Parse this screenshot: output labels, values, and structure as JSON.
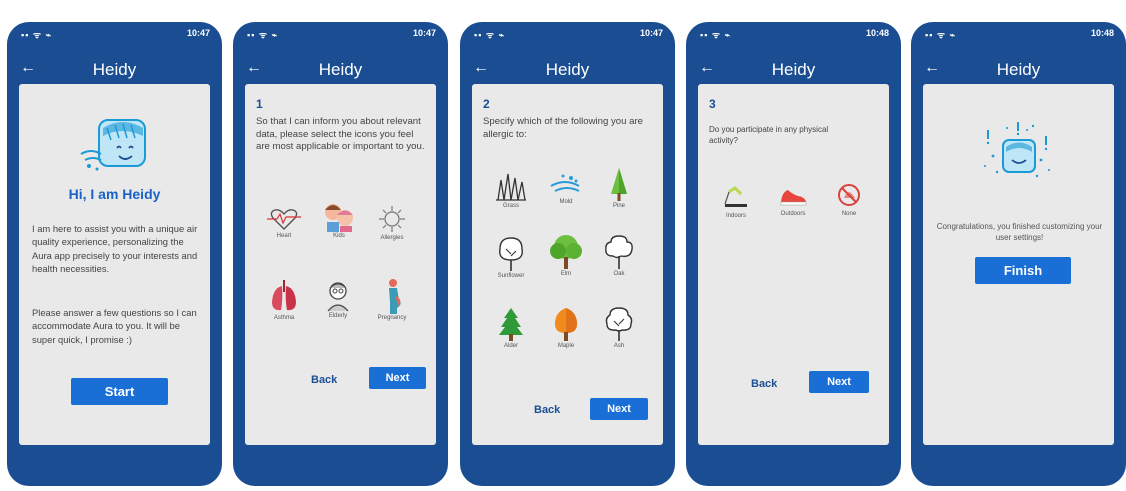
{
  "screens": [
    {
      "time": "10:47",
      "title": "Heidy",
      "greeting": "Hi, I am Heidy",
      "para1": "I am here to assist you with a unique air quality experience, personalizing the Aura app precisely to your interests and health necessities.",
      "para2": "Please answer a few questions so I can accommodate Aura to you. It will be super quick, I promise :)",
      "start_label": "Start"
    },
    {
      "time": "10:47",
      "title": "Heidy",
      "step": "1",
      "question": "So that I can inform you about relevant data, please select the icons you feel are most applicable or important to you.",
      "icons": [
        "Heart",
        "Kids",
        "Allergies",
        "Asthma",
        "Elderly",
        "Pregnancy"
      ],
      "back_label": "Back",
      "next_label": "Next"
    },
    {
      "time": "10:47",
      "title": "Heidy",
      "step": "2",
      "question": "Specify which of the following you are allergic to:",
      "icons": [
        "Grass",
        "Mold",
        "Pine",
        "Sunflower",
        "Elm",
        "Oak",
        "Alder",
        "Maple",
        "Ash"
      ],
      "back_label": "Back",
      "next_label": "Next"
    },
    {
      "time": "10:48",
      "title": "Heidy",
      "step": "3",
      "question": "Do you participate in any physical activity?",
      "icons": [
        "Indoors",
        "Outdoors",
        "None"
      ],
      "back_label": "Back",
      "next_label": "Next"
    },
    {
      "time": "10:48",
      "title": "Heidy",
      "message": "Congratulations, you finished customizing your user settings!",
      "finish_label": "Finish"
    }
  ],
  "colors": {
    "frame": "#1a4d91",
    "card": "#e9e9e9",
    "button": "#1a6fd6",
    "accent_text": "#1b4f94"
  },
  "icon_names": [
    "back-arrow-icon",
    "signal-icon",
    "heidy-avatar-icon"
  ]
}
